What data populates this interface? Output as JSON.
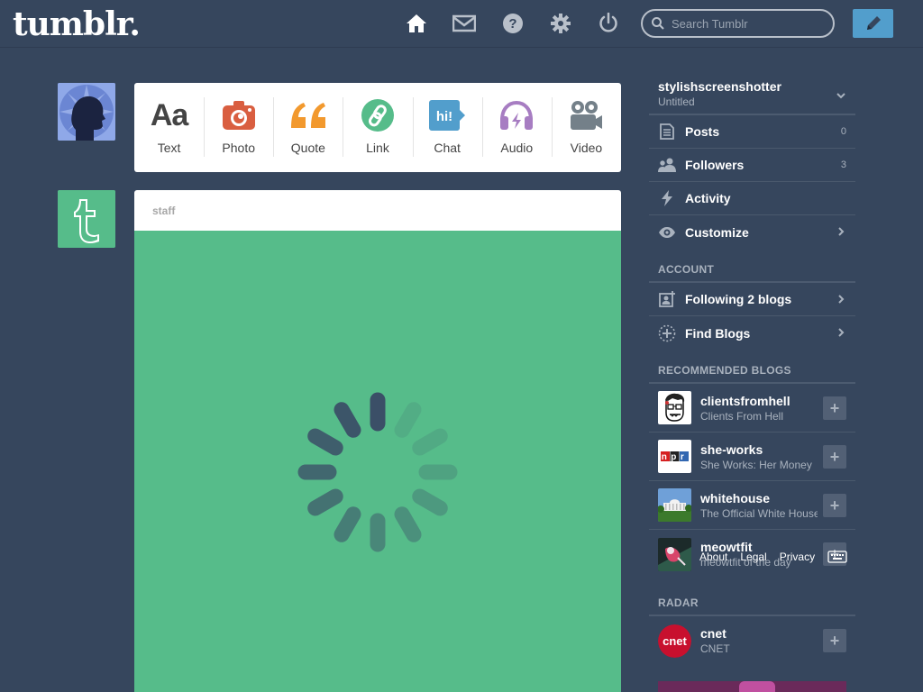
{
  "header": {
    "logo": "tumblr.",
    "search_placeholder": "Search Tumblr"
  },
  "post_types": [
    {
      "label": "Text",
      "icon": "text-icon",
      "color": "#444444"
    },
    {
      "label": "Photo",
      "icon": "camera-icon",
      "color": "#d95e40"
    },
    {
      "label": "Quote",
      "icon": "quote-icon",
      "color": "#f2992e"
    },
    {
      "label": "Link",
      "icon": "link-icon",
      "color": "#56bc8a"
    },
    {
      "label": "Chat",
      "icon": "chat-icon",
      "color": "#529ecc",
      "badge": "hi!"
    },
    {
      "label": "Audio",
      "icon": "headphones-icon",
      "color": "#a77dc2"
    },
    {
      "label": "Video",
      "icon": "video-camera-icon",
      "color": "#748089"
    }
  ],
  "post": {
    "author": "staff",
    "body_color": "#56bc8a"
  },
  "sidebar": {
    "blog_name": "stylishscreenshotter",
    "blog_subtitle": "Untitled",
    "menu": [
      {
        "label": "Posts",
        "count": "0",
        "icon": "document-icon"
      },
      {
        "label": "Followers",
        "count": "3",
        "icon": "people-icon"
      },
      {
        "label": "Activity",
        "icon": "lightning-icon"
      },
      {
        "label": "Customize",
        "icon": "eye-icon"
      }
    ],
    "account_title": "ACCOUNT",
    "account": [
      {
        "label": "Following 2 blogs",
        "icon": "add-person-icon"
      },
      {
        "label": "Find Blogs",
        "icon": "compass-icon"
      }
    ],
    "recommended_title": "RECOMMENDED BLOGS",
    "recommended": [
      {
        "name": "clientsfromhell",
        "desc": "Clients From Hell"
      },
      {
        "name": "she-works",
        "desc": "She Works: Her Money"
      },
      {
        "name": "whitehouse",
        "desc": "The Official White House"
      },
      {
        "name": "meowtfit",
        "desc": "meowtfit of the day"
      }
    ],
    "radar_title": "RADAR",
    "radar": [
      {
        "name": "cnet",
        "desc": "CNET",
        "logo_text": "cnet"
      }
    ],
    "npr_text": "npr"
  },
  "footer": {
    "about": "About",
    "legal": "Legal",
    "privacy": "Privacy"
  },
  "colors": {
    "background": "#36465d",
    "accent": "#529ecc",
    "green": "#56bc8a"
  }
}
